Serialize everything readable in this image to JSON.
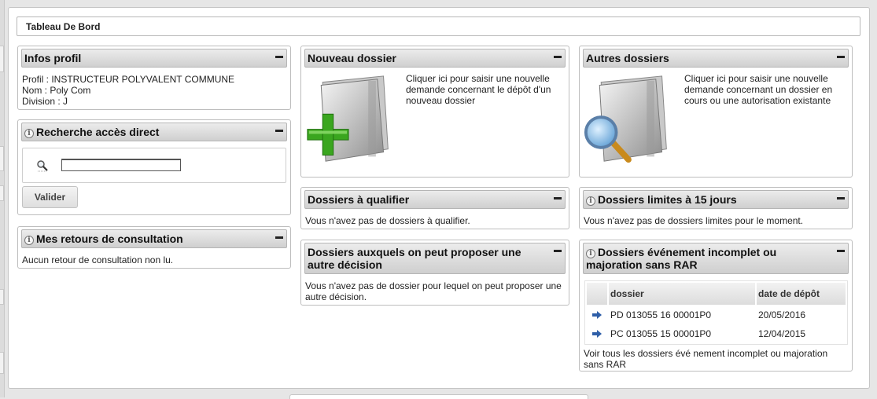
{
  "page_title": "Tableau De Bord",
  "infos_profil": {
    "title": "Infos profil",
    "profil": "Profil : INSTRUCTEUR POLYVALENT COMMUNE",
    "nom": "Nom : Poly Com",
    "division": "Division : J"
  },
  "recherche": {
    "title": "Recherche accès direct",
    "input_value": "",
    "button_label": "Valider"
  },
  "retours": {
    "title": "Mes retours de consultation",
    "message": "Aucun retour de consultation non lu."
  },
  "nouveau_dossier": {
    "title": "Nouveau dossier",
    "text": "Cliquer ici pour saisir une nouvelle demande concernant le dépôt d'un nouveau dossier"
  },
  "autres_dossiers": {
    "title": "Autres dossiers",
    "text": "Cliquer ici pour saisir une nouvelle demande concernant un dossier en cours ou une autorisation existante"
  },
  "a_qualifier": {
    "title": "Dossiers à qualifier",
    "message": "Vous n'avez pas de dossiers à qualifier."
  },
  "limites": {
    "title": "Dossiers limites à 15 jours",
    "message": "Vous n'avez pas de dossiers limites pour le moment."
  },
  "autre_decision": {
    "title": "Dossiers auxquels on peut proposer une autre décision",
    "message": "Vous n'avez pas de dossier pour lequel on peut proposer une autre décision."
  },
  "evenement": {
    "title": "Dossiers événement incomplet ou majoration sans RAR",
    "columns": [
      "dossier",
      "date de dépôt"
    ],
    "rows": [
      {
        "dossier": "PD 013055 16 00001P0",
        "date": "20/05/2016"
      },
      {
        "dossier": "PC 013055 15 00001P0",
        "date": "12/04/2015"
      }
    ],
    "link": "Voir tous les dossiers évé nement incomplet ou majoration sans RAR"
  },
  "colors": {
    "header_top": "#ececec",
    "header_bottom": "#cfcfcf",
    "arrow_blue": "#2f5fa8",
    "plus_green": "#3aa61f"
  }
}
